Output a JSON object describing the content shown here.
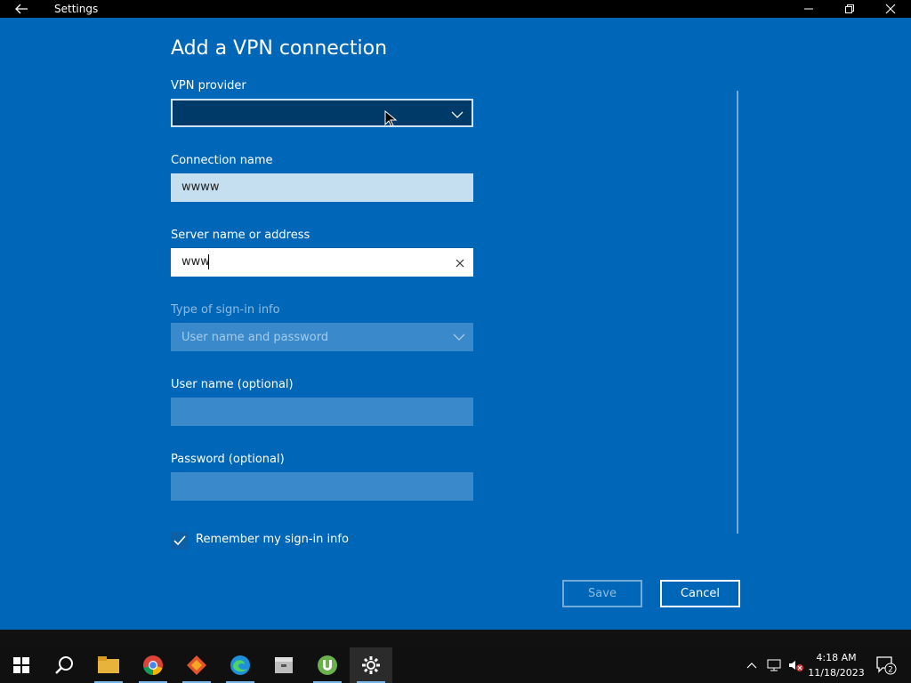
{
  "window": {
    "title": "Settings"
  },
  "dialog": {
    "heading": "Add a VPN connection",
    "vpn_provider": {
      "label": "VPN provider",
      "value": ""
    },
    "connection_name": {
      "label": "Connection name",
      "value": "wwww"
    },
    "server": {
      "label": "Server name or address",
      "value": "www"
    },
    "signin_type": {
      "label": "Type of sign-in info",
      "value": "User name and password"
    },
    "username": {
      "label": "User name (optional)",
      "value": ""
    },
    "password": {
      "label": "Password (optional)",
      "value": ""
    },
    "remember": {
      "label": "Remember my sign-in info",
      "checked": true
    },
    "save_label": "Save",
    "cancel_label": "Cancel"
  },
  "taskbar": {
    "time": "4:18 AM",
    "date": "11/18/2023",
    "notification_count": "2",
    "apps": [
      "start-icon",
      "search-icon",
      "file-explorer-icon",
      "chrome-icon",
      "app-icon",
      "edge-icon",
      "package-icon",
      "utorrent-icon",
      "settings-icon"
    ]
  },
  "colors": {
    "dialog_bg": "#0067b8",
    "taskbar_bg": "#101010"
  }
}
